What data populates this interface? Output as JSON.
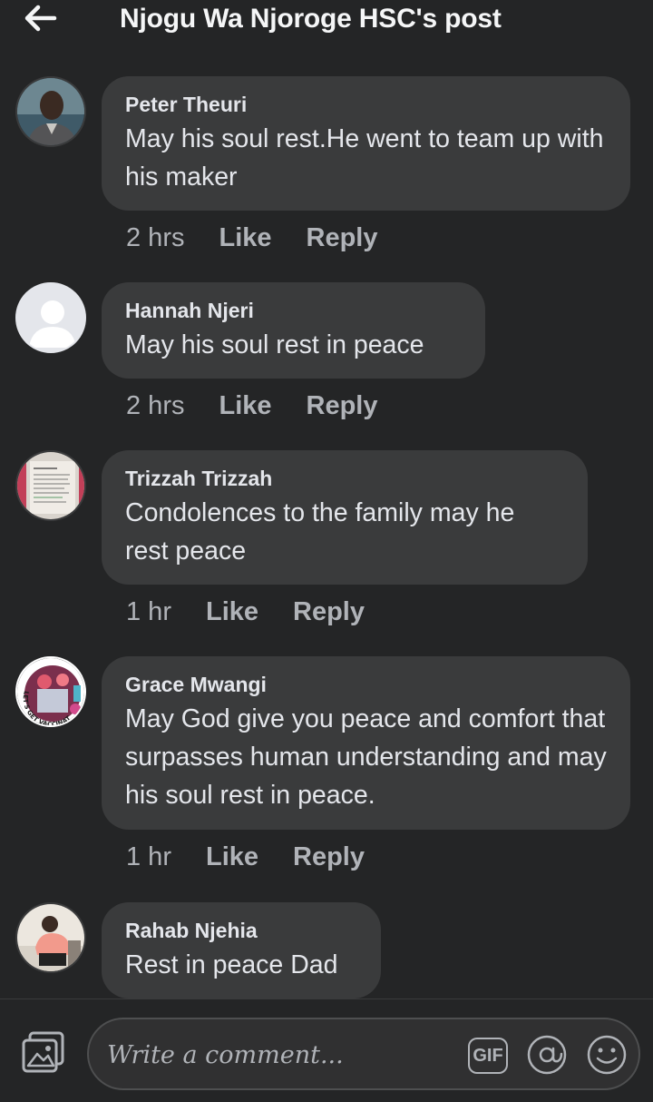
{
  "header": {
    "back_icon": "back-arrow-icon",
    "title": "Njogu Wa Njoroge HSC's post"
  },
  "comments": [
    {
      "author": "Peter Theuri",
      "text": "May his soul rest.He went to team up with his maker",
      "time": "2 hrs",
      "like_label": "Like",
      "reply_label": "Reply"
    },
    {
      "author": "Hannah Njeri",
      "text": "May his soul rest in peace",
      "time": "2 hrs",
      "like_label": "Like",
      "reply_label": "Reply"
    },
    {
      "author": "Trizzah Trizzah",
      "text": "Condolences to the family may he rest peace",
      "time": "1 hr",
      "like_label": "Like",
      "reply_label": "Reply"
    },
    {
      "author": "Grace Mwangi",
      "text": "May God give you peace and comfort that surpasses human understanding and may his soul rest in peace.",
      "time": "1 hr",
      "like_label": "Like",
      "reply_label": "Reply",
      "avatar_badge": "LET'S GET VACCINATED"
    },
    {
      "author": "Rahab Njehia",
      "text": "Rest in peace Dad"
    }
  ],
  "composer": {
    "placeholder": "Write a comment...",
    "gif_label": "GIF",
    "photo_icon": "photo-icon",
    "at_icon": "mention-icon",
    "emoji_icon": "emoji-icon"
  },
  "colors": {
    "background": "#242526",
    "bubble": "#3a3b3c",
    "text_primary": "#e4e6eb",
    "text_secondary": "#b0b3b8"
  }
}
